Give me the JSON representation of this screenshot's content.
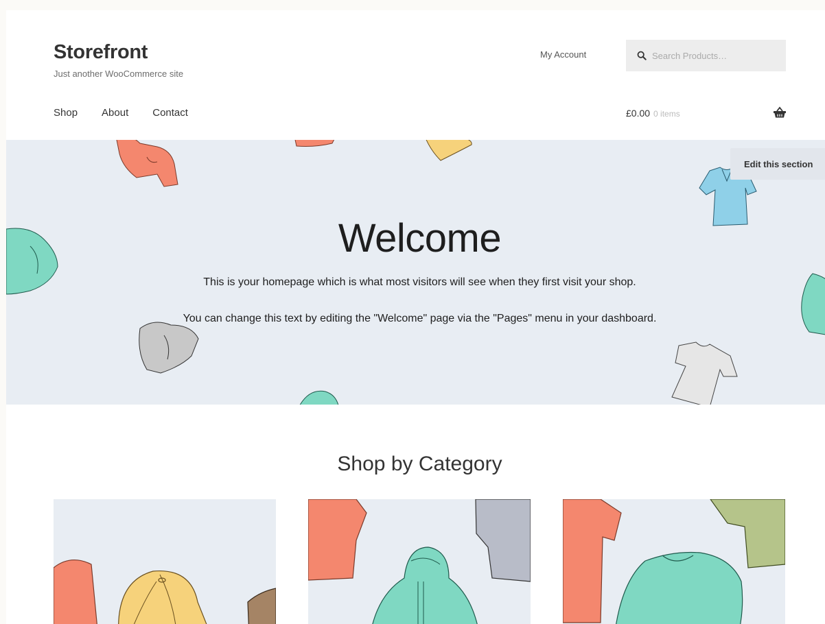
{
  "site": {
    "title": "Storefront",
    "description": "Just another WooCommerce site"
  },
  "header": {
    "my_account": "My Account",
    "search_placeholder": "Search Products…"
  },
  "nav": {
    "items": [
      {
        "label": "Shop"
      },
      {
        "label": "About"
      },
      {
        "label": "Contact"
      }
    ]
  },
  "cart": {
    "total": "£0.00",
    "count": "0 items"
  },
  "hero": {
    "heading": "Welcome",
    "paragraph1": "This is your homepage which is what most visitors will see when they first visit your shop.",
    "paragraph2": "You can change this text by editing the \"Welcome\" page via the \"Pages\" menu in your dashboard.",
    "edit_label": "Edit this section",
    "background_color": "#e8edf3"
  },
  "categories": {
    "heading": "Shop by Category",
    "cards": [
      {
        "icon": "hats-illustration"
      },
      {
        "icon": "hoodies-illustration"
      },
      {
        "icon": "tshirts-illustration"
      }
    ]
  },
  "colors": {
    "coral": "#f4876e",
    "mint": "#7fd8c2",
    "yellow": "#f6d27b",
    "blue": "#8fd0e8",
    "grey": "#c8c8c8",
    "olive": "#b5c48a"
  }
}
